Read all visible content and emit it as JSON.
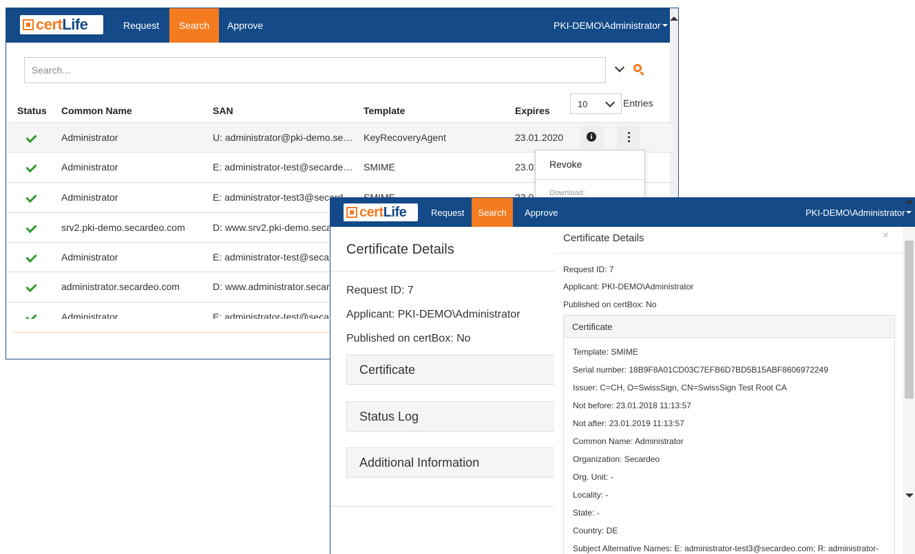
{
  "colors": {
    "nav_bg": "#134a87",
    "accent": "#f47b20",
    "check": "#2e9b2e"
  },
  "brand": {
    "logo_part1": "cert",
    "logo_part2": "Life"
  },
  "nav": {
    "request": "Request",
    "search": "Search",
    "approve": "Approve",
    "user": "PKI-DEMO\\Administrator"
  },
  "search": {
    "placeholder": "Search..."
  },
  "table": {
    "headers": {
      "status": "Status",
      "common_name": "Common Name",
      "san": "SAN",
      "template": "Template",
      "expires": "Expires"
    },
    "entries_value": "10",
    "entries_label": "Entries",
    "rows": [
      {
        "common_name": "Administrator",
        "san": "U: administrator@pki-demo.se…",
        "template": "KeyRecoveryAgent",
        "expires": "23.01.2020"
      },
      {
        "common_name": "Administrator",
        "san": "E: administrator-test@secarde…",
        "template": "SMIME",
        "expires": "23.01"
      },
      {
        "common_name": "Administrator",
        "san": "E: administrator-test3@secard…",
        "template": "SMIME",
        "expires": "23.0"
      },
      {
        "common_name": "srv2.pki-demo.secardeo.com",
        "san": "D: www.srv2.pki-demo.seca",
        "template": "",
        "expires": ""
      },
      {
        "common_name": "Administrator",
        "san": "E: administrator-test@seca",
        "template": "",
        "expires": ""
      },
      {
        "common_name": "administrator.secardeo.com",
        "san": "D: www.administrator.secar",
        "template": "",
        "expires": ""
      },
      {
        "common_name": "Administrator",
        "san": "E: administrator-test@seca",
        "template": "",
        "expires": ""
      }
    ]
  },
  "dropdown": {
    "revoke": "Revoke",
    "download_label": "Download:"
  },
  "details": {
    "title": "Certificate Details",
    "request_id": "Request ID: 7",
    "applicant": "Applicant: PKI-DEMO\\Administrator",
    "published": "Published on certBox: No",
    "sections": {
      "certificate": "Certificate",
      "status_log": "Status Log",
      "additional": "Additional Information"
    }
  },
  "panel": {
    "title": "Certificate Details",
    "close": "×",
    "request_id": "Request ID: 7",
    "applicant": "Applicant: PKI-DEMO\\Administrator",
    "published": "Published on certBox: No",
    "cert_header": "Certificate",
    "cert_lines": [
      "Template: SMIME",
      "Serial number: 18B9F8A01CD03C7EFB6D7BD5B15ABF8606972249",
      "Issuer: C=CH, O=SwissSign, CN=SwissSign Test Root CA",
      "Not before: 23.01.2018 11:13:57",
      "Not after: 23.01.2019 11:13:57",
      "Common Name: Administrator",
      "Organization: Secardeo",
      "Org. Unit: -",
      "Locality: -",
      "State: -",
      "Country: DE",
      "Subject Alternative Names: E: administrator-test3@secardeo.com; R: administrator-"
    ]
  }
}
